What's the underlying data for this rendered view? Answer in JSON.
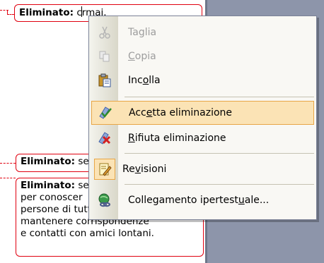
{
  "balloons": {
    "b1": {
      "label": "Eliminato:",
      "text_before": " c",
      "text_after": "rmai."
    },
    "b2": {
      "label": "Eliminato:",
      "text": " se"
    },
    "b3": {
      "label": "Eliminato:",
      "first_text": " se",
      "lines": [
        "per conoscer",
        "persone di tutto il mondo o",
        "mantenere corrispondenze",
        "e contatti con amici lontani."
      ]
    }
  },
  "context_menu": {
    "items": [
      {
        "pre": "Taglia",
        "ul": "",
        "post": "",
        "icon": "cut-icon",
        "disabled": true
      },
      {
        "pre": "",
        "ul": "C",
        "post": "opia",
        "icon": "copy-icon",
        "disabled": true
      },
      {
        "pre": "Inc",
        "ul": "o",
        "post": "lla",
        "icon": "paste-icon",
        "disabled": false
      },
      {
        "pre": "Acc",
        "ul": "e",
        "post": "tta eliminazione",
        "icon": "accept-change-icon",
        "highlighted": true
      },
      {
        "pre": "",
        "ul": "R",
        "post": "ifiuta eliminazione",
        "icon": "reject-change-icon"
      },
      {
        "pre": "Re",
        "ul": "v",
        "post": "isioni",
        "icon": "reviewing-icon"
      },
      {
        "pre": "Collegamento ipertest",
        "ul": "u",
        "post": "ale...",
        "icon": "hyperlink-icon"
      }
    ]
  },
  "colors": {
    "balloon_border": "#e0000f",
    "highlight_fill": "#fbe3b5",
    "highlight_border": "#e8a646",
    "gray_pane": "#8d95aa"
  }
}
